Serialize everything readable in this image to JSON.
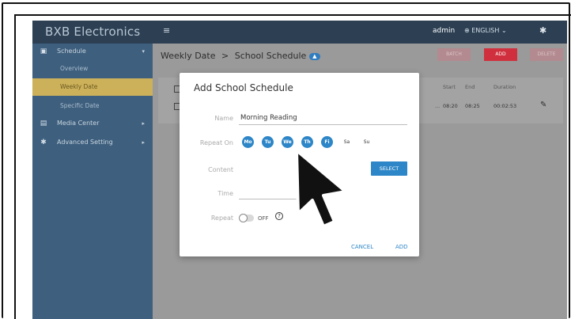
{
  "brand": "BXB Electronics",
  "header": {
    "menu_icon": "hamburger-icon",
    "user": "admin",
    "language": "ENGLISH",
    "language_icon": "globe-icon",
    "settings_icon": "gear-icon"
  },
  "sidebar": {
    "items": [
      {
        "label": "Schedule",
        "icon": "calendar-icon",
        "expanded": true
      },
      {
        "label": "Media Center",
        "icon": "media-icon"
      },
      {
        "label": "Advanced Setting",
        "icon": "gear-icon"
      }
    ],
    "subitems": [
      {
        "label": "Overview"
      },
      {
        "label": "Weekly Date",
        "active": true
      },
      {
        "label": "Specific Date"
      }
    ]
  },
  "breadcrumb": {
    "parent": "Weekly Date",
    "separator": ">",
    "current": "School Schedule",
    "badge_icon": "upload-icon"
  },
  "toolbar": {
    "batch": "BATCH",
    "add": "ADD",
    "delete": "DELETE"
  },
  "table": {
    "headers": [
      "Start",
      "End",
      "Duration"
    ],
    "rows": [
      {
        "start": "08:20",
        "end": "08:25",
        "duration": "00:02:53",
        "ellipsis": "..."
      }
    ]
  },
  "modal": {
    "title": "Add School Schedule",
    "name_label": "Name",
    "name_value": "Morning Reading",
    "repeat_on_label": "Repeat On",
    "days": [
      {
        "label": "Mo",
        "selected": true
      },
      {
        "label": "Tu",
        "selected": true
      },
      {
        "label": "We",
        "selected": true
      },
      {
        "label": "Th",
        "selected": true
      },
      {
        "label": "Fi",
        "selected": true
      },
      {
        "label": "Sa",
        "selected": false
      },
      {
        "label": "Su",
        "selected": false
      }
    ],
    "content_label": "Content",
    "select_button": "SELECT",
    "time_label": "Time",
    "repeat_label": "Repeat",
    "repeat_state": "OFF",
    "help_symbol": "?",
    "cancel": "CANCEL",
    "add": "ADD"
  },
  "colors": {
    "sidebar": "#3e5f7e",
    "topbar": "#2c3f53",
    "active_item": "#cdb15a",
    "accent": "#2d86c7",
    "danger": "#d0303d"
  }
}
